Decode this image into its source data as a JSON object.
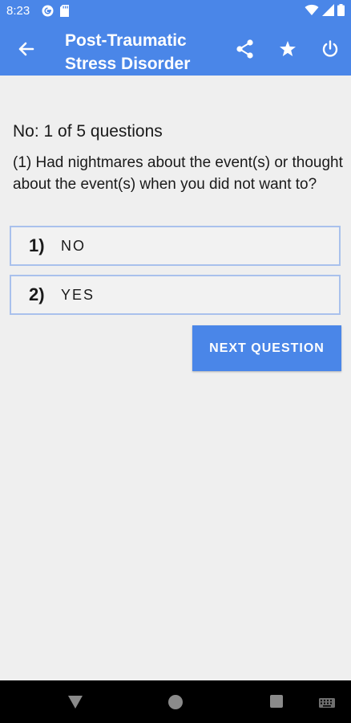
{
  "status_bar": {
    "time": "8:23",
    "left_icons": [
      "g-circle-icon",
      "sd-card-icon"
    ],
    "right_icons": [
      "wifi-icon",
      "signal-icon",
      "battery-icon"
    ]
  },
  "app_bar": {
    "title": "Post-Traumatic\nStress Disorder",
    "color": "#4a86e8",
    "actions": [
      "share-icon",
      "star-icon",
      "power-icon"
    ]
  },
  "quiz": {
    "progress": "No: 1 of 5 questions",
    "question": "(1) Had nightmares about the event(s) or thought about the event(s) when you did not want to?",
    "options": [
      {
        "number": "1)",
        "label": "NO"
      },
      {
        "number": "2)",
        "label": "YES"
      }
    ],
    "next_button": "NEXT QUESTION"
  },
  "nav_bar": {
    "buttons": [
      "back-icon",
      "home-icon",
      "recents-icon",
      "keyboard-icon"
    ]
  }
}
